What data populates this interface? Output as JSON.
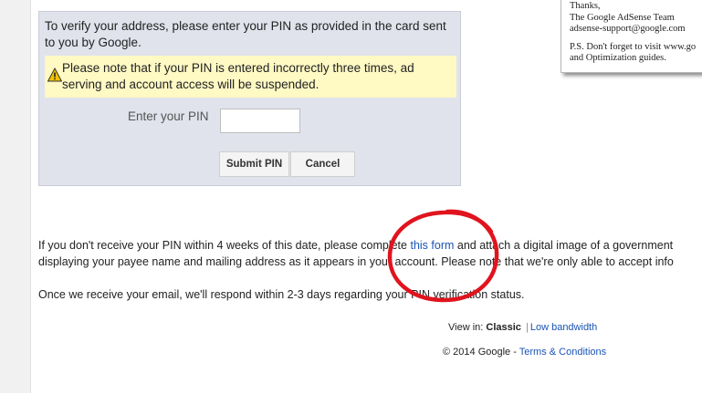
{
  "verify_panel": {
    "intro_text": "To verify your address, please enter your PIN as provided in the card sent to you by Google.",
    "warning_text": "Please note that if your PIN is entered incorrectly three times, ad serving and account access will be suspended.",
    "warning_icon": "warning-triangle-icon",
    "pin_label": "Enter your PIN",
    "pin_value": "",
    "submit_label": "Submit PIN",
    "cancel_label": "Cancel"
  },
  "body_text": {
    "line1_before_link": "If you don't receive your PIN within 4 weeks of this date, please complete ",
    "link_text": "this form",
    "line1_after_link": " and attach a digital image of a government",
    "line2": "displaying your payee name and mailing address as it appears in your account. Please note that we're only able to accept info",
    "para2": "Once we receive your email, we'll respond within 2-3 days regarding your PIN verification status."
  },
  "footer": {
    "view_in_label": "View in:",
    "classic": "Classic",
    "separator": "|",
    "low_bandwidth": "Low bandwidth",
    "copyright": "© 2014 Google",
    "dash": " - ",
    "terms": "Terms & Conditions"
  },
  "letter": {
    "line1": "Thanks,",
    "line2": "The Google AdSense Team",
    "line3": "adsense-support@google.com",
    "line4": "P.S. Don't forget to visit www.go",
    "line5": "and Optimization guides."
  },
  "colors": {
    "panel_bg": "#e0e3ec",
    "warning_bg": "#fff9c4",
    "link": "#1a54b5",
    "annotation_circle": "#e0141e"
  }
}
